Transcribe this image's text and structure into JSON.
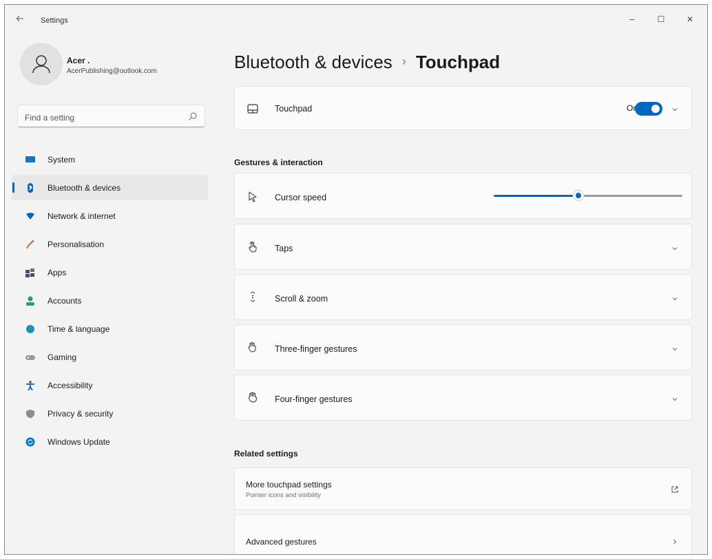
{
  "window": {
    "title": "Settings",
    "controls": {
      "minimize": "–",
      "maximize": "☐",
      "close": "✕"
    }
  },
  "profile": {
    "name": "Acer .",
    "email": "AcerPublishing@outlook.com"
  },
  "search": {
    "placeholder": "Find a setting"
  },
  "sidebar": {
    "items": [
      {
        "label": "System",
        "icon": "system-icon",
        "color": "#0078d4",
        "selected": false
      },
      {
        "label": "Bluetooth & devices",
        "icon": "bluetooth-icon",
        "color": "#0067c0",
        "selected": true
      },
      {
        "label": "Network & internet",
        "icon": "wifi-icon",
        "color": "#0067c0",
        "selected": false
      },
      {
        "label": "Personalisation",
        "icon": "brush-icon",
        "color": "#c46a2a",
        "selected": false
      },
      {
        "label": "Apps",
        "icon": "apps-icon",
        "color": "#4a4a6a",
        "selected": false
      },
      {
        "label": "Accounts",
        "icon": "accounts-icon",
        "color": "#2e9e5a",
        "selected": false
      },
      {
        "label": "Time & language",
        "icon": "globe-icon",
        "color": "#1a8cd8",
        "selected": false
      },
      {
        "label": "Gaming",
        "icon": "gamepad-icon",
        "color": "#8a8a8a",
        "selected": false
      },
      {
        "label": "Accessibility",
        "icon": "accessibility-icon",
        "color": "#1a5fb4",
        "selected": false
      },
      {
        "label": "Privacy & security",
        "icon": "shield-icon",
        "color": "#7a7a8a",
        "selected": false
      },
      {
        "label": "Windows Update",
        "icon": "update-icon",
        "color": "#0078d4",
        "selected": false
      }
    ]
  },
  "main": {
    "breadcrumb_parent": "Bluetooth & devices",
    "breadcrumb_separator": "›",
    "breadcrumb_current": "Touchpad",
    "touchpad_card": {
      "label": "Touchpad",
      "toggle_state": "On",
      "toggle_on": true
    },
    "gestures_heading": "Gestures & interaction",
    "cursor_speed": {
      "label": "Cursor speed",
      "value_fraction": 0.45
    },
    "gesture_items": [
      {
        "label": "Taps",
        "icon": "tap-icon"
      },
      {
        "label": "Scroll & zoom",
        "icon": "scroll-icon"
      },
      {
        "label": "Three-finger gestures",
        "icon": "three-finger-icon"
      },
      {
        "label": "Four-finger gestures",
        "icon": "four-finger-icon"
      }
    ],
    "related_heading": "Related settings",
    "more_touchpad": {
      "label": "More touchpad settings",
      "sublabel": "Pointer icons and visibility"
    },
    "advanced_gestures": {
      "label": "Advanced gestures"
    }
  },
  "colors": {
    "accent": "#0067c0",
    "background": "#f3f3f3",
    "card": "#fbfbfb"
  }
}
